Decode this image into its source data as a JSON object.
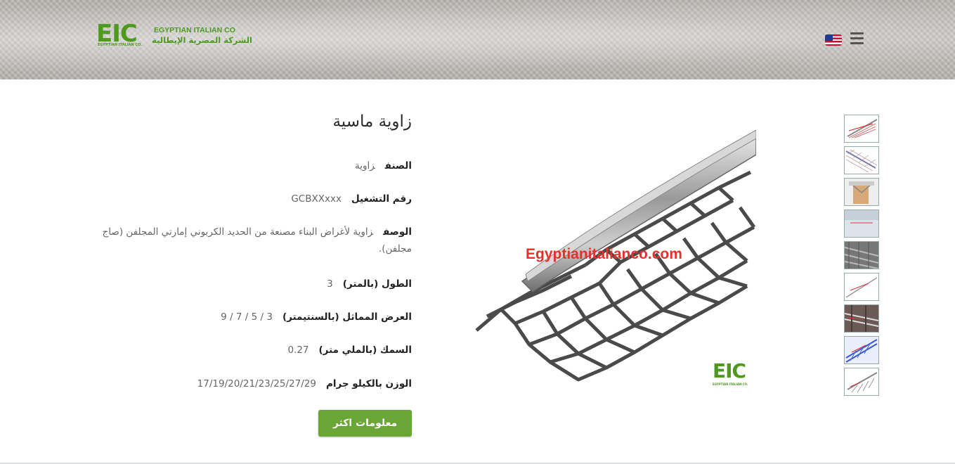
{
  "header": {
    "logo_mark": "EIC",
    "logo_sub": "EGYPTIAN ITALIAN CO.",
    "logo_en": "EGYPTIAN ITALIAN CO",
    "logo_ar": "الشركة المصرية الإيطالية",
    "language_flag_icon": "us-flag-icon",
    "menu_icon": "hamburger-icon"
  },
  "product": {
    "title": "زاوية ماسية",
    "rows": [
      {
        "label": "الصنف",
        "value": "زاوية"
      },
      {
        "label": "رقم التشغيل",
        "value": "GCBXXxxx"
      },
      {
        "label": "الوصف",
        "value": "زاوية لأغراض البناء مصنعة من الحديد الكربوني إمارتي المجلفن (صاج مجلفن)."
      },
      {
        "label": "الطول (بالمتر)",
        "value": "3"
      },
      {
        "label": "العرض المماثل (بالسنتيمتر)",
        "value": "3 / 5 / 7 / 9"
      },
      {
        "label": "السمك (بالملي متر)",
        "value": "0.27"
      },
      {
        "label": "الوزن بالكيلو جرام",
        "value": "17/19/20/21/23/25/27/29"
      }
    ],
    "more_button": "معلومات اكثر"
  },
  "image": {
    "watermark": "Egyptianitalianco.com",
    "logo_mark": "EIC",
    "logo_sub": "EGYPTIAN ITALIAN CO."
  },
  "thumbnails": [
    "thumb-1",
    "thumb-2",
    "thumb-3",
    "thumb-4",
    "thumb-5",
    "thumb-6",
    "thumb-7",
    "thumb-8",
    "thumb-9"
  ],
  "colors": {
    "brand_green": "#6aa636",
    "watermark_red": "#e6302a"
  }
}
